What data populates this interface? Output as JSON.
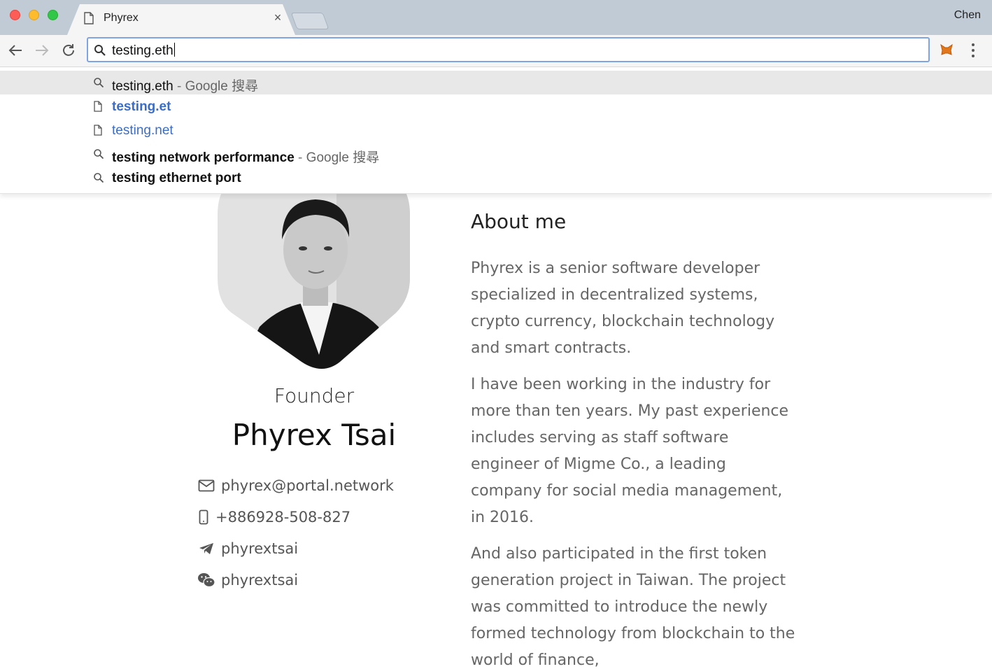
{
  "browser": {
    "tab_title": "Phyrex",
    "profile_name": "Chen",
    "omnibox_value": "testing.eth"
  },
  "suggestions": [
    {
      "icon": "search-icon",
      "text": "testing.eth",
      "separator": " - ",
      "engine": "Google 搜尋",
      "kind": "search"
    },
    {
      "icon": "page-icon",
      "text": "testing.et",
      "separator": "",
      "engine": "",
      "kind": "url-bold"
    },
    {
      "icon": "page-icon",
      "text": "testing.net",
      "separator": "",
      "engine": "",
      "kind": "url"
    },
    {
      "icon": "search-icon",
      "text": "testing network performance",
      "separator": " - ",
      "engine": "Google 搜尋",
      "kind": "search-bold"
    },
    {
      "icon": "search-icon",
      "text": "testing ethernet port",
      "separator": "",
      "engine": "",
      "kind": "search-bold"
    }
  ],
  "profile": {
    "role": "Founder",
    "name": "Phyrex Tsai",
    "contacts": [
      {
        "icon": "envelope-icon",
        "text": "phyrex@portal.network"
      },
      {
        "icon": "phone-icon",
        "text": "+886928-508-827"
      },
      {
        "icon": "telegram-icon",
        "text": "phyrextsai"
      },
      {
        "icon": "wechat-icon",
        "text": "phyrextsai"
      }
    ]
  },
  "about": {
    "title": "About me",
    "paragraphs": [
      "Phyrex is a senior software developer specialized in decentralized systems, crypto currency, blockchain technology and smart contracts.",
      "I have been working in the industry for more than ten years. My past experience includes serving as staff software engineer of Migme Co., a leading company for social media management, in 2016.",
      "And also participated in the first token generation project in Taiwan. The project was committed to introduce the newly formed technology from blockchain to the world of finance,"
    ]
  },
  "colors": {
    "omnibox_focus": "#7ea4e6",
    "suggestion_url": "#3b6dc6",
    "selected_row": "#e8e8e8"
  }
}
